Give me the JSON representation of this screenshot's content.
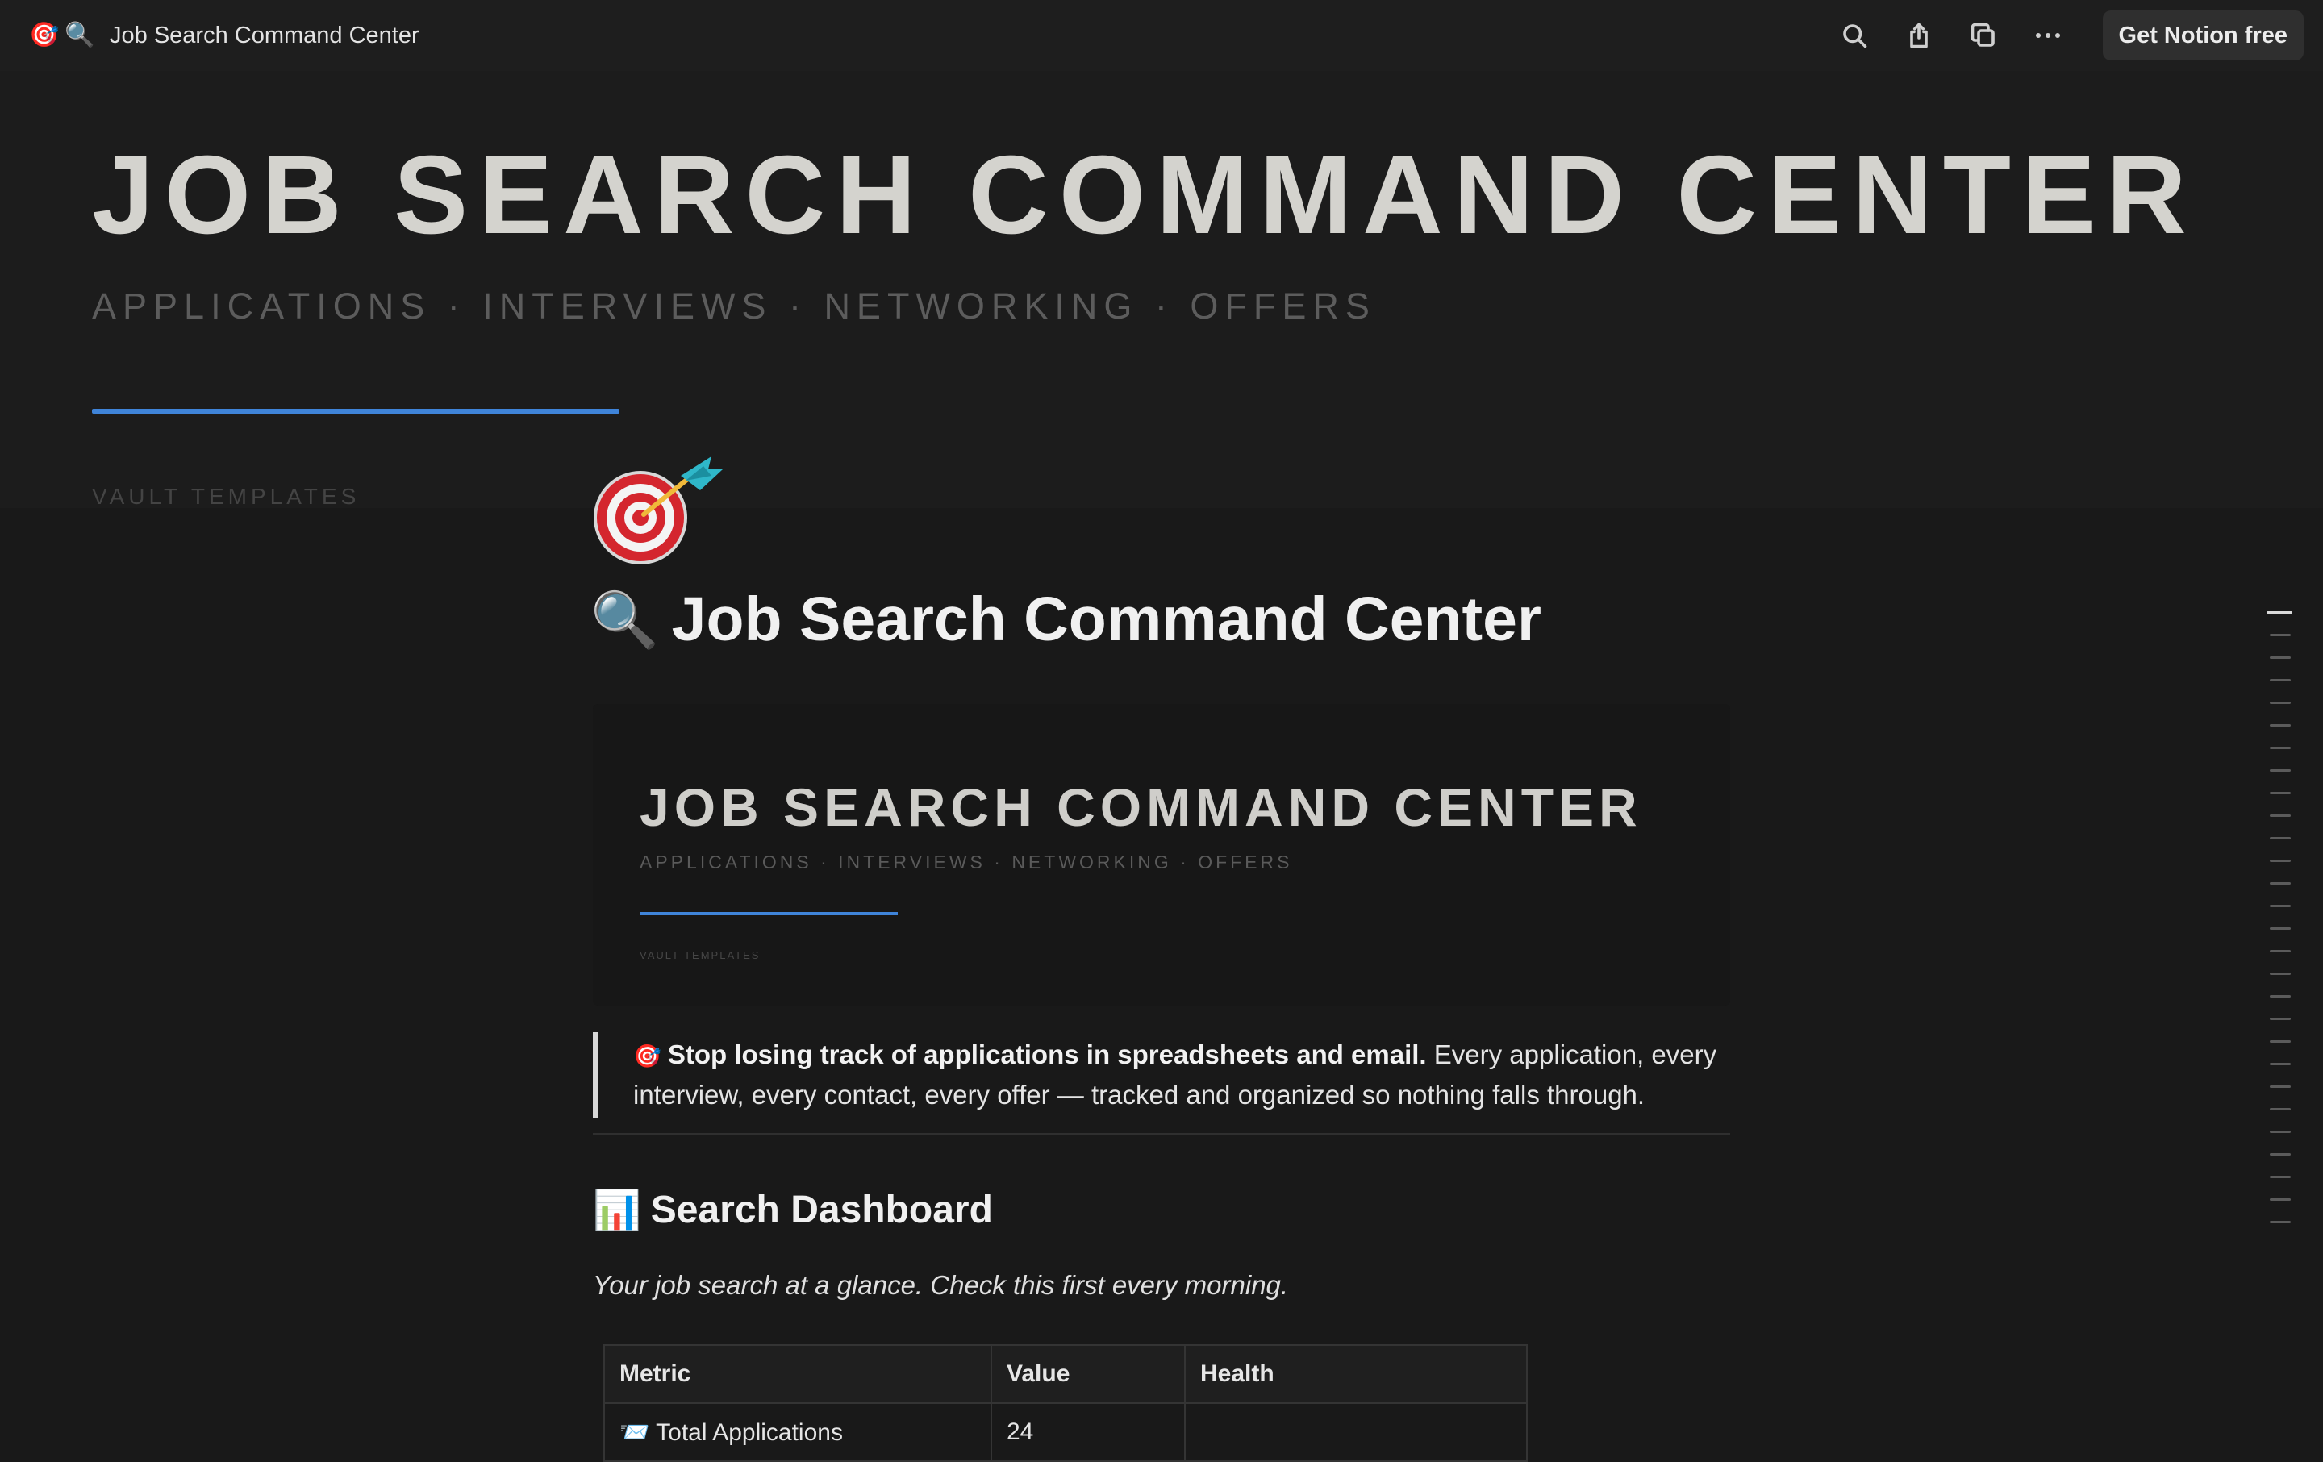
{
  "topbar": {
    "emoji_target": "🎯",
    "emoji_search": "🔍",
    "title": "Job Search Command Center",
    "icons": [
      "search-icon",
      "share-icon",
      "duplicate-icon",
      "more-icon"
    ],
    "cta": "Get Notion free"
  },
  "cover": {
    "title": "JOB SEARCH COMMAND CENTER",
    "subtitle": "APPLICATIONS · INTERVIEWS · NETWORKING · OFFERS",
    "vault": "VAULT TEMPLATES",
    "accent": "#3f84d9"
  },
  "page": {
    "icon": "target-dart-icon",
    "title_emoji": "🔍",
    "title": "Job Search Command Center"
  },
  "embed": {
    "title": "JOB SEARCH COMMAND CENTER",
    "subtitle": "APPLICATIONS · INTERVIEWS · NETWORKING · OFFERS",
    "vault": "VAULT TEMPLATES"
  },
  "callout": {
    "emoji": "🎯",
    "bold": "Stop losing track of applications in spreadsheets and email.",
    "text": " Every application, every interview, every contact, every offer — tracked and organized so nothing falls through."
  },
  "dashboard": {
    "emoji": "📊",
    "heading": "Search Dashboard",
    "lead": "Your job search at a glance. Check this first every morning.",
    "columns": [
      "Metric",
      "Value",
      "Health"
    ],
    "rows": [
      {
        "emoji": "📨",
        "metric": "Total Applications",
        "value": "24",
        "health": ""
      }
    ]
  },
  "toc_count": 28
}
